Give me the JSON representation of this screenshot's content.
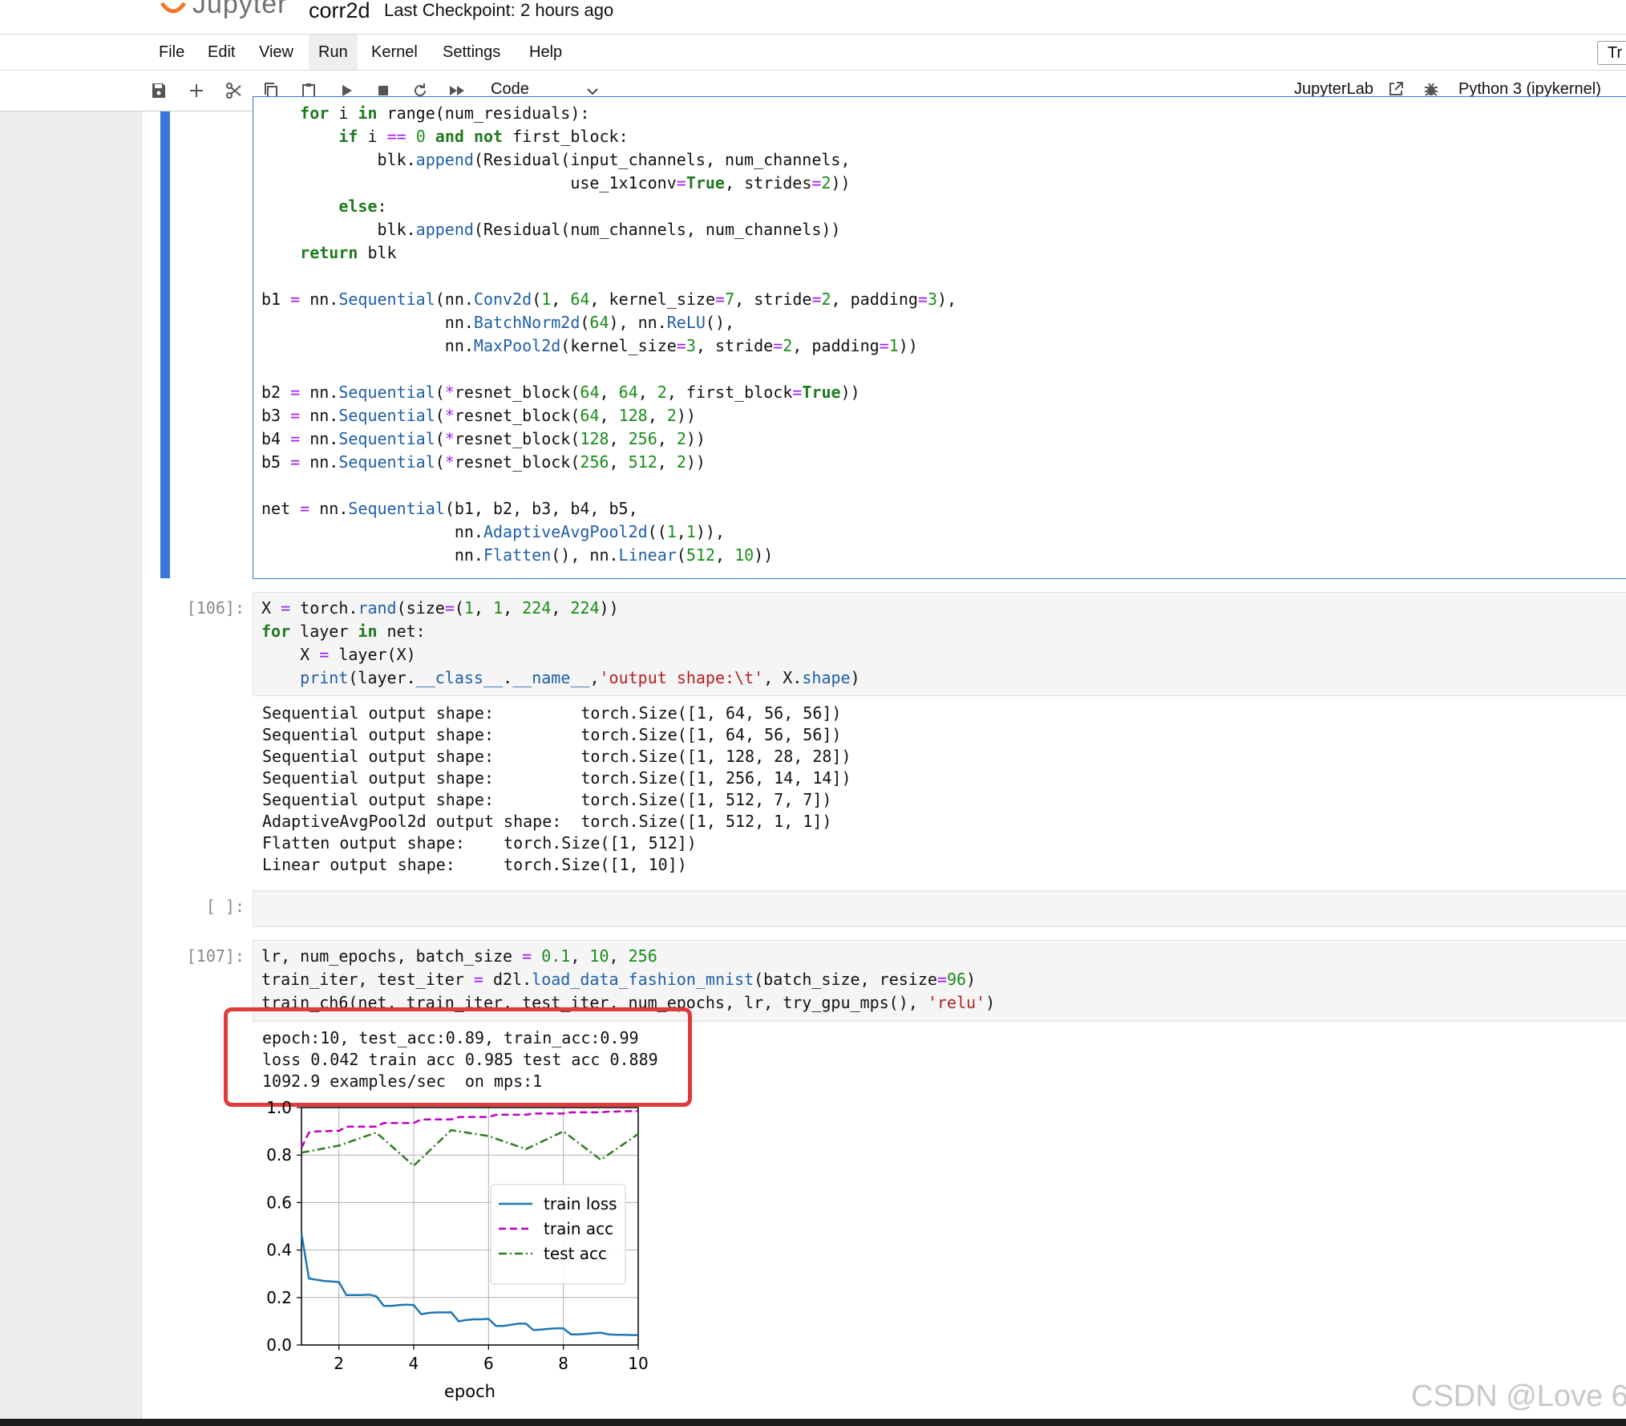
{
  "header": {
    "brand": "Jupyter",
    "notebook_title": "corr2d",
    "checkpoint": "Last Checkpoint: 2 hours ago"
  },
  "menu": {
    "file": "File",
    "edit": "Edit",
    "view": "View",
    "run": "Run",
    "kernel": "Kernel",
    "settings": "Settings",
    "help": "Help",
    "right_truncated": "Tr"
  },
  "toolbar": {
    "cell_type": "Code",
    "jupyterlab_link": "JupyterLab",
    "kernel_name": "Python 3 (ipykernel)"
  },
  "cells": {
    "cell1_prompt": "",
    "cell2_prompt": "[106]:",
    "cell3_prompt": "[ ]:",
    "cell4_prompt": "[107]:",
    "cell2_output": "Sequential output shape:\t torch.Size([1, 64, 56, 56])\nSequential output shape:\t torch.Size([1, 64, 56, 56])\nSequential output shape:\t torch.Size([1, 128, 28, 28])\nSequential output shape:\t torch.Size([1, 256, 14, 14])\nSequential output shape:\t torch.Size([1, 512, 7, 7])\nAdaptiveAvgPool2d output shape:\t torch.Size([1, 512, 1, 1])\nFlatten output shape:\t torch.Size([1, 512])\nLinear output shape:\t torch.Size([1, 10])",
    "cell4_output": "epoch:10, test_acc:0.89, train_acc:0.99\nloss 0.042 train acc 0.985 test acc 0.889\n1092.9 examples/sec  on mps:1"
  },
  "colors": {
    "accent": "#3a75d8",
    "highlight": "#e03b3b",
    "train_loss": "#1f77b4",
    "train_acc": "#bf00bf",
    "test_acc": "#2e7d20"
  },
  "chart_data": {
    "type": "line",
    "xlabel": "epoch",
    "ylabel": "",
    "xlim": [
      1,
      10
    ],
    "ylim": [
      0,
      1.0
    ],
    "x_ticks": [
      2,
      4,
      6,
      8,
      10
    ],
    "y_ticks": [
      0.0,
      0.2,
      0.4,
      0.6,
      0.8,
      1.0
    ],
    "grid": true,
    "legend_position": "center-right",
    "series": [
      {
        "name": "train loss",
        "style": "solid",
        "x": [
          1.0,
          1.2,
          1.4,
          1.6,
          1.8,
          2.0,
          2.2,
          2.4,
          2.6,
          2.8,
          3.0,
          3.2,
          3.4,
          3.6,
          3.8,
          4.0,
          4.2,
          4.4,
          4.6,
          4.8,
          5.0,
          5.2,
          5.4,
          5.6,
          5.8,
          6.0,
          6.2,
          6.4,
          6.6,
          6.8,
          7.0,
          7.2,
          7.4,
          7.6,
          7.8,
          8.0,
          8.2,
          8.4,
          8.6,
          8.8,
          9.0,
          9.2,
          9.4,
          9.6,
          9.8,
          10.0
        ],
        "y": [
          0.47,
          0.28,
          0.275,
          0.27,
          0.268,
          0.265,
          0.21,
          0.21,
          0.21,
          0.212,
          0.205,
          0.165,
          0.165,
          0.168,
          0.17,
          0.168,
          0.13,
          0.135,
          0.137,
          0.137,
          0.138,
          0.1,
          0.105,
          0.108,
          0.108,
          0.11,
          0.08,
          0.08,
          0.085,
          0.09,
          0.09,
          0.063,
          0.065,
          0.068,
          0.07,
          0.07,
          0.045,
          0.045,
          0.047,
          0.05,
          0.052,
          0.045,
          0.043,
          0.043,
          0.042,
          0.042
        ]
      },
      {
        "name": "train acc",
        "style": "dashed",
        "x": [
          1.0,
          1.2,
          1.4,
          1.6,
          1.8,
          2.0,
          2.2,
          2.4,
          2.6,
          2.8,
          3.0,
          3.2,
          3.4,
          3.6,
          3.8,
          4.0,
          4.2,
          4.4,
          4.6,
          4.8,
          5.0,
          5.2,
          5.4,
          5.6,
          5.8,
          6.0,
          6.2,
          6.4,
          6.6,
          6.8,
          7.0,
          7.2,
          7.4,
          7.6,
          7.8,
          8.0,
          8.2,
          8.4,
          8.6,
          8.8,
          9.0,
          9.2,
          9.4,
          9.6,
          9.8,
          10.0
        ],
        "y": [
          0.83,
          0.895,
          0.9,
          0.9,
          0.902,
          0.902,
          0.92,
          0.92,
          0.92,
          0.92,
          0.92,
          0.935,
          0.935,
          0.935,
          0.935,
          0.935,
          0.95,
          0.95,
          0.95,
          0.95,
          0.95,
          0.96,
          0.96,
          0.96,
          0.96,
          0.96,
          0.97,
          0.97,
          0.97,
          0.97,
          0.97,
          0.975,
          0.975,
          0.975,
          0.975,
          0.975,
          0.98,
          0.98,
          0.98,
          0.98,
          0.98,
          0.983,
          0.983,
          0.984,
          0.985,
          0.985
        ]
      },
      {
        "name": "test acc",
        "style": "dashdot",
        "x": [
          1,
          2,
          3,
          4,
          5,
          6,
          7,
          8,
          9,
          10
        ],
        "y": [
          0.81,
          0.84,
          0.895,
          0.755,
          0.905,
          0.88,
          0.825,
          0.9,
          0.78,
          0.889
        ]
      }
    ]
  },
  "watermark": "CSDN @Love 6"
}
